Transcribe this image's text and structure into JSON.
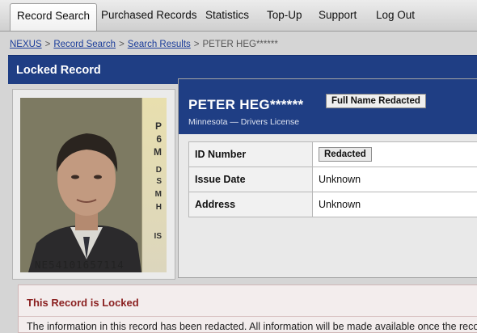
{
  "nav": {
    "tabs": [
      {
        "label": "Record Search",
        "active": true
      },
      {
        "label": "Purchased Records"
      },
      {
        "label": "Statistics"
      },
      {
        "label": "Top-Up"
      },
      {
        "label": "Support"
      },
      {
        "label": "Log Out"
      }
    ]
  },
  "breadcrumb": {
    "items": [
      "NEXUS",
      "Record Search",
      "Search Results",
      "PETER HEG******"
    ]
  },
  "locked_header": "Locked Record",
  "license_photo": {
    "side_text": [
      "P",
      "6",
      "M",
      "D",
      "S",
      "M",
      "H",
      "IS"
    ],
    "number": "NE54101657114"
  },
  "record": {
    "name": "PETER HEG******",
    "badge": "Full Name Redacted",
    "subtitle": "Minnesota — Drivers License",
    "rows": [
      {
        "key": "ID Number",
        "value": "Redacted"
      },
      {
        "key": "Issue Date",
        "value": "Unknown"
      },
      {
        "key": "Address",
        "value": "Unknown"
      }
    ]
  },
  "notice": {
    "title": "This Record is Locked",
    "text": "The information in this record has been redacted. All information will be made available once the record"
  },
  "colors": {
    "header_blue": "#1f3e84",
    "notice_red": "#8a1f1f",
    "link_blue": "#1a3c9a"
  }
}
